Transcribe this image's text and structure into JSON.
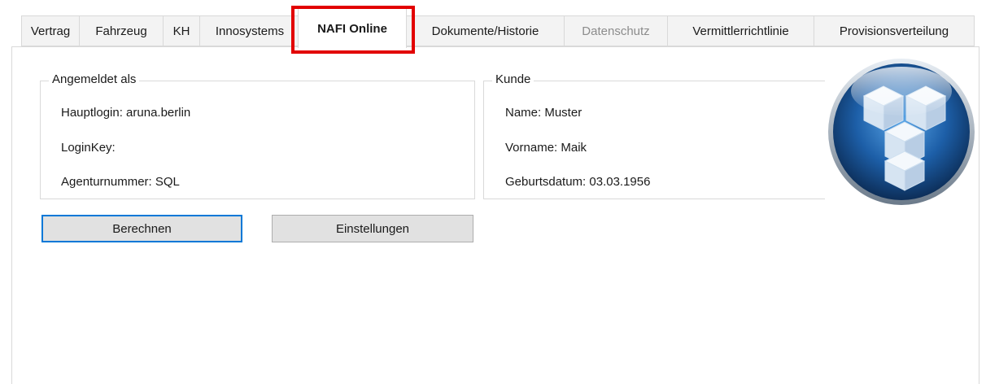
{
  "tabs": [
    {
      "label": "Vertrag",
      "state": "normal"
    },
    {
      "label": "Fahrzeug",
      "state": "normal"
    },
    {
      "label": "KH",
      "state": "normal"
    },
    {
      "label": "Innosystems",
      "state": "normal"
    },
    {
      "label": "NAFI Online",
      "state": "active"
    },
    {
      "label": "Dokumente/Historie",
      "state": "normal"
    },
    {
      "label": "Datenschutz",
      "state": "disabled"
    },
    {
      "label": "Vermittlerrichtlinie",
      "state": "normal"
    },
    {
      "label": "Provisionsverteilung",
      "state": "normal"
    }
  ],
  "login_group": {
    "title": "Angemeldet als",
    "hauptlogin": "Hauptlogin: aruna.berlin",
    "loginkey": "LoginKey:",
    "agenturnummer": "Agenturnummer: SQL"
  },
  "customer_group": {
    "title": "Kunde",
    "name": "Name: Muster",
    "vorname": "Vorname: Maik",
    "geburtsdatum": "Geburtsdatum: 03.03.1956"
  },
  "buttons": {
    "calculate": "Berechnen",
    "settings": "Einstellungen"
  },
  "colors": {
    "highlight": "#e20000",
    "focus_border": "#0078d7",
    "logo_blue": "#1d5fa8"
  },
  "logo": {
    "icon": "cubes-logo-icon"
  }
}
